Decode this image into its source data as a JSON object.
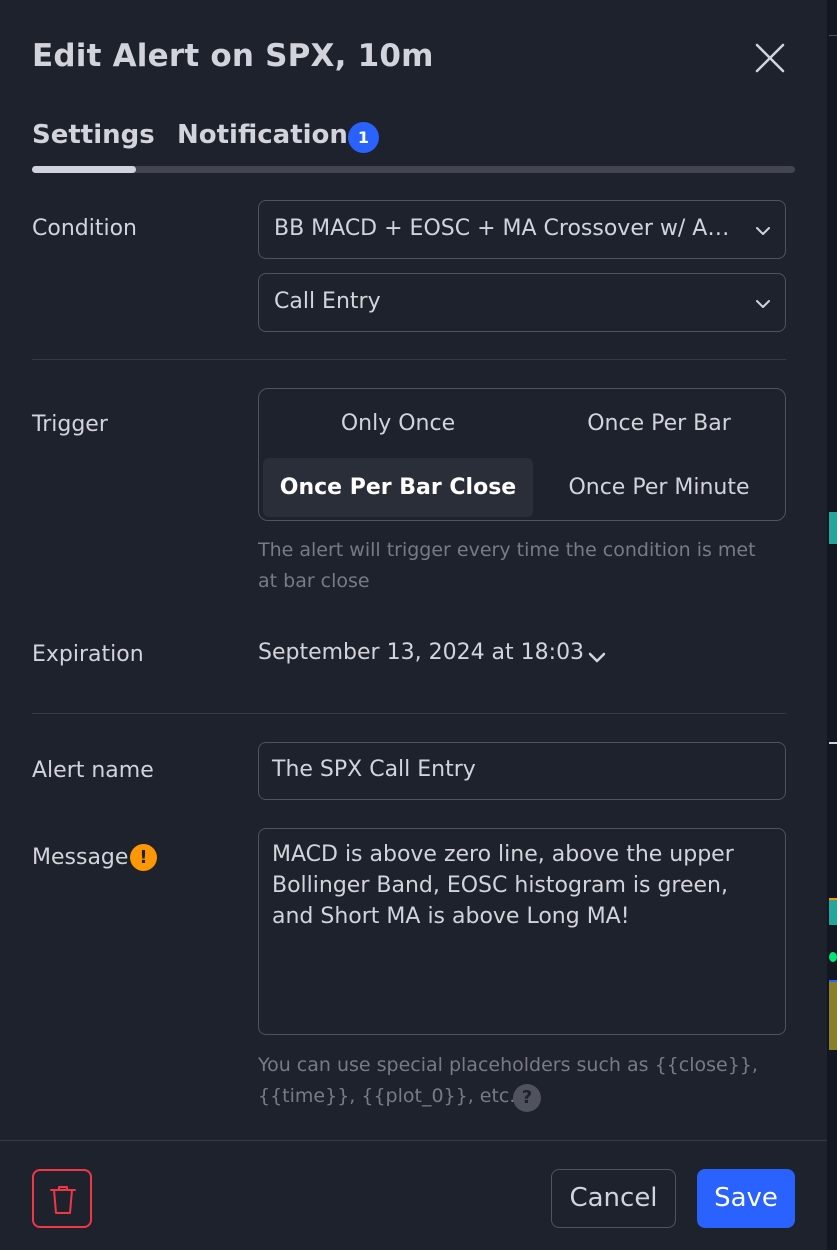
{
  "dialog": {
    "title": "Edit Alert on SPX, 10m"
  },
  "tabs": [
    {
      "label": "Settings",
      "active": true
    },
    {
      "label": "Notifications",
      "badge": "1"
    }
  ],
  "condition": {
    "label": "Condition",
    "indicator": "BB MACD + EOSC + MA Crossover w/ Alert...",
    "alert_condition": "Call Entry"
  },
  "trigger": {
    "label": "Trigger",
    "options": [
      "Only Once",
      "Once Per Bar",
      "Once Per Bar Close",
      "Once Per Minute"
    ],
    "selected": "Once Per Bar Close",
    "hint": "The alert will trigger every time the condition is met at bar close"
  },
  "expiration": {
    "label": "Expiration",
    "value": "September 13, 2024 at 18:03"
  },
  "alert_name": {
    "label": "Alert name",
    "value": "The SPX Call Entry"
  },
  "message": {
    "label": "Message",
    "value": "MACD is above zero line, above the upper Bollinger Band, EOSC histogram is green, and Short MA is above Long MA!",
    "hint": "You can use special placeholders such as {{close}}, {{time}}, {{plot_0}}, etc."
  },
  "footer": {
    "cancel_label": "Cancel",
    "save_label": "Save"
  },
  "icons": {
    "close": "close-icon",
    "chevron": "chevron-down-icon",
    "warning": "warning-icon",
    "help": "help-icon",
    "delete": "trash-icon"
  },
  "colors": {
    "background": "#1e222d",
    "accent": "#2962ff",
    "danger": "#f23645",
    "warning": "#ff9800",
    "text": "#d1d4dc",
    "muted": "#787b86"
  }
}
